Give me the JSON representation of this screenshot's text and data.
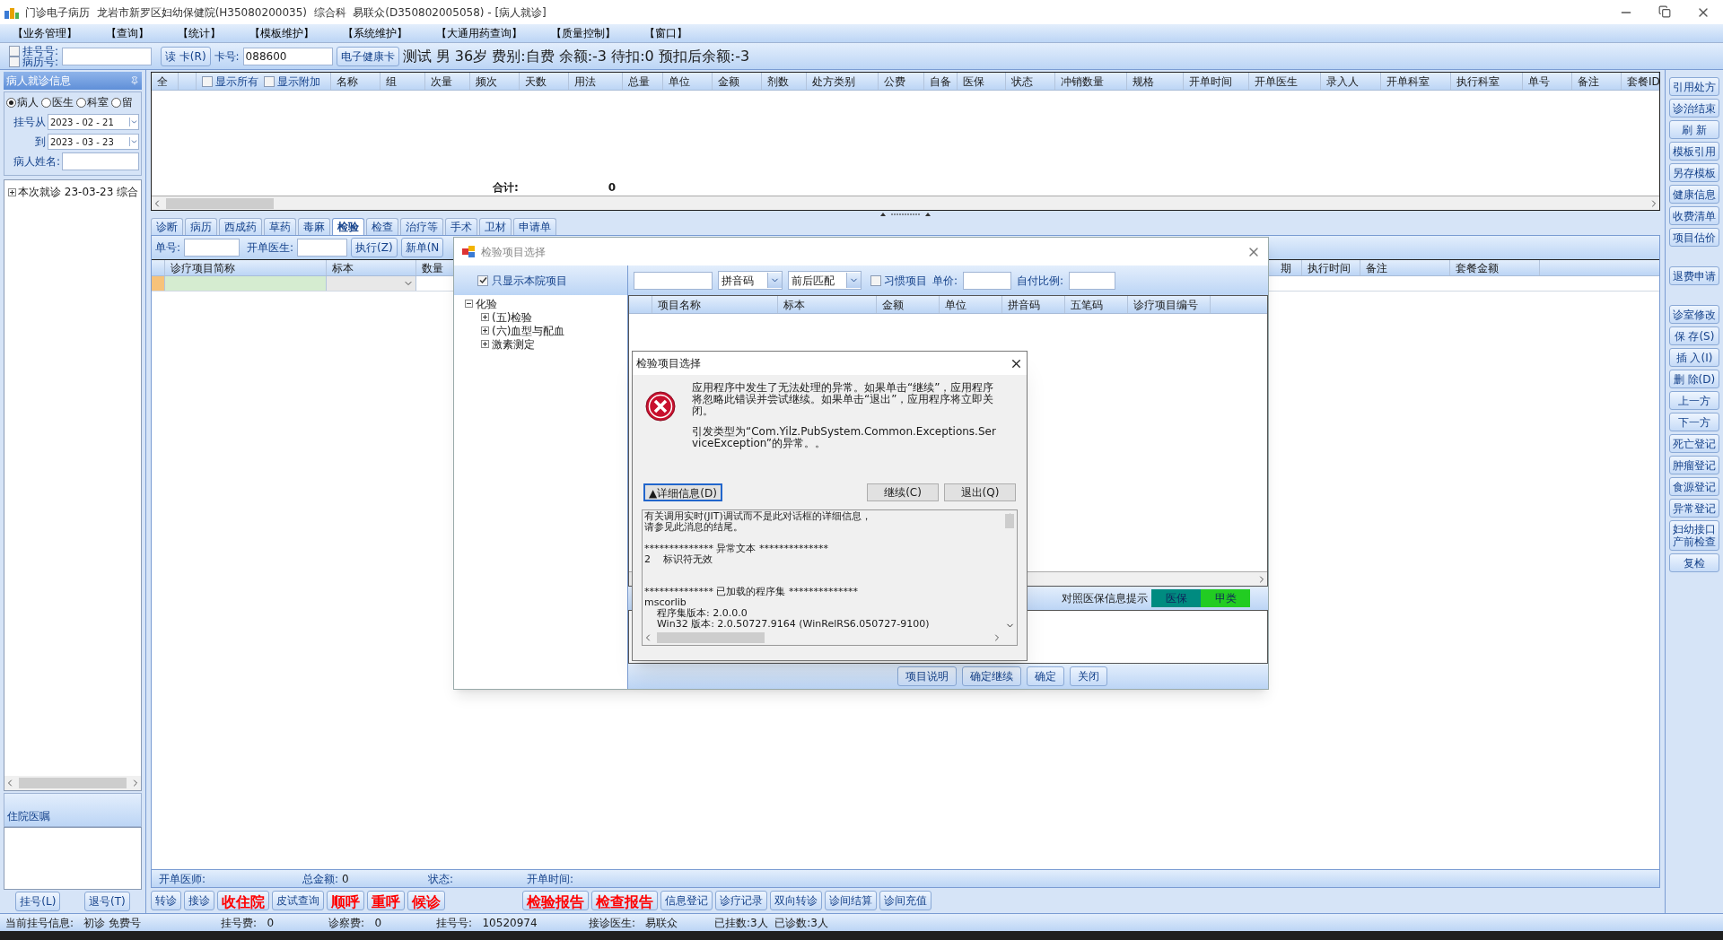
{
  "window": {
    "title": "门诊电子病历  龙岩市新罗区妇幼保健院(H35080200035)  综合科  易联众(D350802005058) - [病人就诊]"
  },
  "menu": [
    "【业务管理】",
    "【查询】",
    "【统计】",
    "【模板维护】",
    "【系统维护】",
    "【大通用药查询】",
    "【质量控制】",
    "【窗口】"
  ],
  "toolbar": {
    "checks": [
      {
        "label": "挂号号:",
        "checked": false
      },
      {
        "label": "病历号:",
        "checked": false
      }
    ],
    "read_card_button": "读 卡(R)",
    "card_label": "卡号:",
    "card_value": "088600",
    "health_card_button": "电子健康卡",
    "patient_info": "测试 男 36岁 费别:自费 余额:-3 待扣:0 预扣后余额:-3"
  },
  "left_panel": {
    "title": "病人就诊信息",
    "filters": [
      {
        "label": "病人",
        "selected": true
      },
      {
        "label": "医生",
        "selected": false
      },
      {
        "label": "科室",
        "selected": false
      },
      {
        "label": "留",
        "selected": false
      }
    ],
    "date_from_label": "挂号从",
    "date_from": "2023 - 02 - 21",
    "date_to_label": "到",
    "date_to": "2023 - 03 - 23",
    "name_label": "病人姓名:",
    "tree": [
      {
        "label": "本次就诊 23-03-23 综合",
        "expanded": false
      }
    ],
    "orders_title": "住院医嘱",
    "buttons": [
      "挂号(L)",
      "退号(T)"
    ]
  },
  "prescription_grid": {
    "select_all": "全",
    "options": [
      {
        "label": "显示所有",
        "checked": false
      },
      {
        "label": "显示附加",
        "checked": false
      }
    ],
    "columns": [
      "名称",
      "组",
      "次量",
      "频次",
      "天数",
      "用法",
      "总量",
      "单位",
      "金额",
      "剂数",
      "处方类别",
      "公费",
      "自备",
      "医保",
      "状态",
      "冲销数量",
      "规格",
      "开单时间",
      "开单医生",
      "录入人",
      "开单科室",
      "执行科室",
      "单号",
      "备注",
      "套餐ID"
    ],
    "total_label": "合计:",
    "total_value": "0"
  },
  "tabs": [
    {
      "label": "诊断",
      "selected": false
    },
    {
      "label": "病历",
      "selected": false
    },
    {
      "label": "西成药",
      "selected": false
    },
    {
      "label": "草药",
      "selected": false
    },
    {
      "label": "毒麻",
      "selected": false
    },
    {
      "label": "检验",
      "selected": true
    },
    {
      "label": "检查",
      "selected": false
    },
    {
      "label": "治疗等",
      "selected": false
    },
    {
      "label": "手术",
      "selected": false
    },
    {
      "label": "卫材",
      "selected": false
    },
    {
      "label": "申请单",
      "selected": false
    }
  ],
  "order_toolbar": {
    "order_no_label": "单号:",
    "doctor_label": "开单医生:",
    "buttons": [
      "执行(Z)",
      "新单(N"
    ]
  },
  "order_grid": {
    "columns_left": [
      "诊疗项目简称",
      "标本",
      "数量"
    ],
    "columns_right": [
      "期",
      "执行时间",
      "备注",
      "套餐金额"
    ]
  },
  "footer": [
    {
      "label": "开单医师:"
    },
    {
      "label": "总金额:",
      "value": "0"
    },
    {
      "label": "状态:"
    },
    {
      "label": "开单时间:"
    }
  ],
  "actions_left": [
    {
      "label": "转诊",
      "emphasis": false
    },
    {
      "label": "接诊",
      "emphasis": false
    },
    {
      "label": "收住院",
      "emphasis": true
    },
    {
      "label": "皮试查询",
      "emphasis": false
    },
    {
      "label": "顺呼",
      "emphasis": true
    },
    {
      "label": "重呼",
      "emphasis": true
    },
    {
      "label": "候诊",
      "emphasis": true
    }
  ],
  "actions_right": [
    {
      "label": "检验报告",
      "emphasis": true
    },
    {
      "label": "检查报告",
      "emphasis": true
    },
    {
      "label": "信息登记",
      "emphasis": false
    },
    {
      "label": "诊疗记录",
      "emphasis": false
    },
    {
      "label": "双向转诊",
      "emphasis": false
    },
    {
      "label": "诊间结算",
      "emphasis": false
    },
    {
      "label": "诊间充值",
      "emphasis": false
    }
  ],
  "status_bar": [
    "当前挂号信息:   初诊 免费号",
    "挂号费:   0",
    "诊察费:   0",
    "挂号号:   10520974",
    "接诊医生:   易联众",
    "已挂数:3人  已诊数:3人"
  ],
  "side_buttons": [
    [
      "引用处方",
      "诊治结束",
      "刷 新",
      "模板引用",
      "另存模板",
      "健康信息",
      "收费清单",
      "项目估价"
    ],
    [
      "退费申请"
    ],
    [
      "诊室修改",
      "保 存(S)",
      "插 入(I)",
      "删 除(D)",
      "上一方",
      "下一方",
      "死亡登记",
      "肿瘤登记",
      "食源登记",
      "异常登记",
      "妇幼接口产前检查",
      "复检"
    ]
  ],
  "item_dialog": {
    "title": "检验项目选择",
    "local_only": {
      "label": "只显示本院项目",
      "checked": true
    },
    "tree": [
      {
        "label": "化验",
        "expanded": true,
        "children": [
          {
            "label": "(五)检验",
            "expanded": false
          },
          {
            "label": "(六)血型与配血",
            "expanded": false
          },
          {
            "label": "激素测定",
            "expanded": false
          }
        ]
      }
    ],
    "code_type": "拼音码",
    "match_mode": "前后匹配",
    "habit": {
      "label": "习惯项目",
      "checked": false
    },
    "price_label": "单价:",
    "ratio_label": "自付比例:",
    "columns": [
      "项目名称",
      "标本",
      "金额",
      "单位",
      "拼音码",
      "五笔码",
      "诊疗项目编号"
    ],
    "insurance_label": "对照医保信息提示",
    "insurance_tags": [
      {
        "label": "医保",
        "color": "#008b80"
      },
      {
        "label": "甲类",
        "color": "#22cc22"
      }
    ],
    "buttons": [
      "项目说明",
      "确定继续",
      "确定",
      "关闭"
    ]
  },
  "error_dialog": {
    "title": "检验项目选择",
    "message": "应用程序中发生了无法处理的异常。如果单击“继续”，应用程序将忽略此错误并尝试继续。如果单击“退出”，应用程序将立即关闭。",
    "exception": "引发类型为“Com.Yilz.PubSystem.Common.Exceptions.ServiceException”的异常。。",
    "details_button": "▲详细信息(D)",
    "buttons": [
      "继续(C)",
      "退出(Q)"
    ],
    "details": [
      [
        "有关调用实时(JIT)调试而不是此对话框的详细信息，",
        "请参见此消息的结尾。"
      ],
      [
        "************** 异常文本 **************",
        "2    标识符无效"
      ],
      [
        "************** 已加载的程序集 **************",
        "mscorlib",
        "    程序集版本: 2.0.0.0",
        "    Win32 版本: 2.0.50727.9164 (WinRelRS6.050727-9100)"
      ]
    ]
  }
}
